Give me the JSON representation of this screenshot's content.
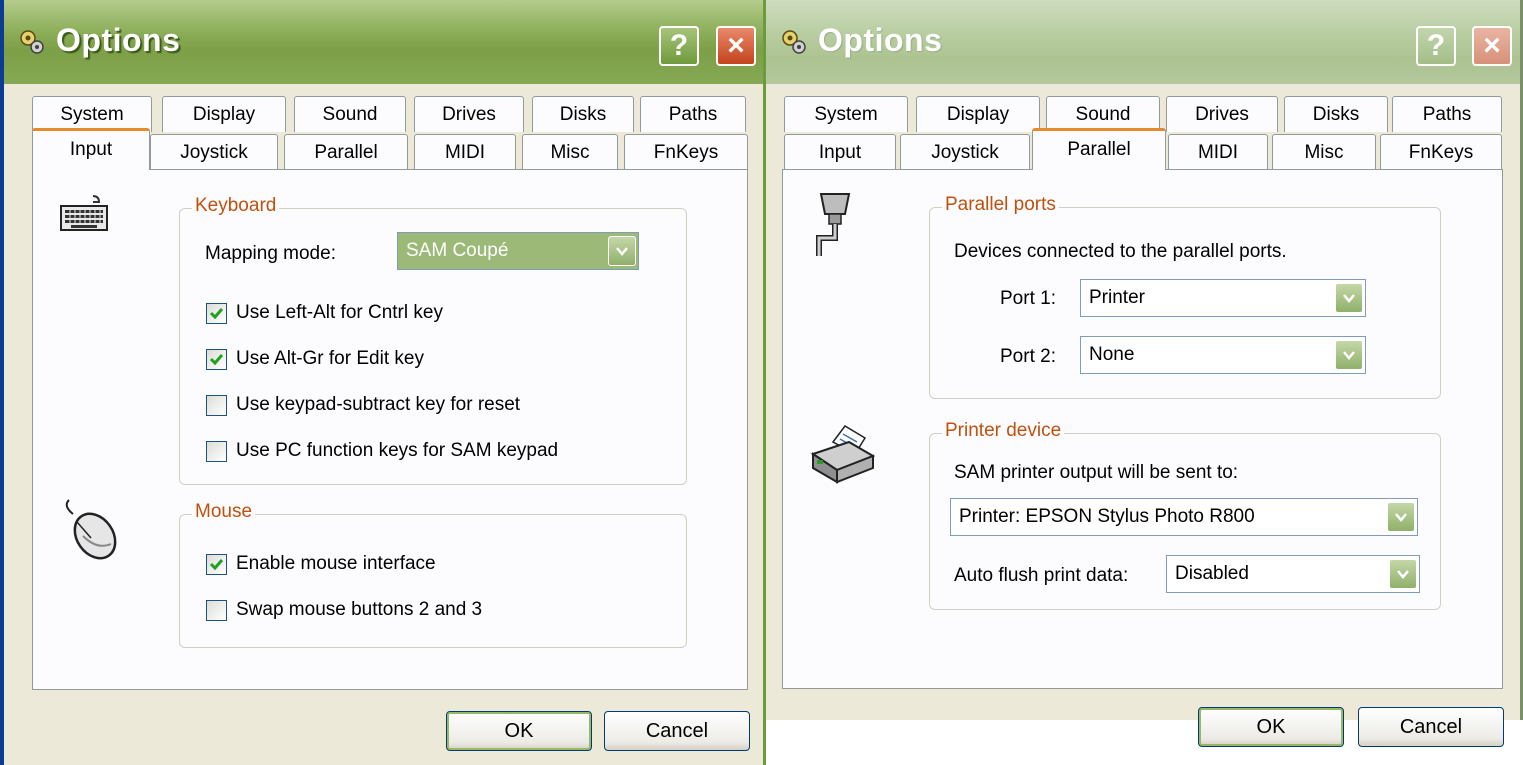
{
  "dialogs": [
    {
      "title": "Options",
      "help_label": "?",
      "close_label": "×",
      "tabs_row1": [
        "System",
        "Display",
        "Sound",
        "Drives",
        "Disks",
        "Paths"
      ],
      "tabs_row2": [
        "Input",
        "Joystick",
        "Parallel",
        "MIDI",
        "Misc",
        "FnKeys"
      ],
      "active_tab": "Input",
      "keyboard": {
        "group_label": "Keyboard",
        "mapping_label": "Mapping mode:",
        "mapping_value": "SAM Coupé",
        "options": [
          {
            "label": "Use Left-Alt for Cntrl key",
            "checked": true
          },
          {
            "label": "Use Alt-Gr for Edit key",
            "checked": true
          },
          {
            "label": "Use keypad-subtract key for reset",
            "checked": false
          },
          {
            "label": "Use PC function keys for SAM keypad",
            "checked": false
          }
        ]
      },
      "mouse": {
        "group_label": "Mouse",
        "options": [
          {
            "label": "Enable mouse interface",
            "checked": true
          },
          {
            "label": "Swap mouse buttons 2 and 3",
            "checked": false
          }
        ]
      },
      "ok_label": "OK",
      "cancel_label": "Cancel",
      "icons": [
        "keyboard-icon",
        "mouse-icon",
        "options-gear-icon",
        "check-icon",
        "dropdown-arrow-icon"
      ]
    },
    {
      "title": "Options",
      "help_label": "?",
      "close_label": "×",
      "tabs_row1": [
        "System",
        "Display",
        "Sound",
        "Drives",
        "Disks",
        "Paths"
      ],
      "tabs_row2": [
        "Input",
        "Joystick",
        "Parallel",
        "MIDI",
        "Misc",
        "FnKeys"
      ],
      "active_tab": "Parallel",
      "parallel_ports": {
        "group_label": "Parallel ports",
        "description": "Devices connected to the parallel ports.",
        "port1_label": "Port 1:",
        "port1_value": "Printer",
        "port2_label": "Port 2:",
        "port2_value": "None"
      },
      "printer_device": {
        "group_label": "Printer device",
        "description": "SAM printer output will be sent to:",
        "printer_value": "Printer: EPSON Stylus Photo R800",
        "flush_label": "Auto flush print data:",
        "flush_value": "Disabled"
      },
      "ok_label": "OK",
      "cancel_label": "Cancel",
      "icons": [
        "parallel-cable-icon",
        "printer-icon",
        "options-gear-icon",
        "dropdown-arrow-icon"
      ]
    }
  ],
  "colors": {
    "titlebar": "#7c9f47",
    "tab_highlight": "#e68b2c",
    "group_label": "#c0510c",
    "dialog_bg": "#ece9d8",
    "checkmark": "#21a121"
  }
}
